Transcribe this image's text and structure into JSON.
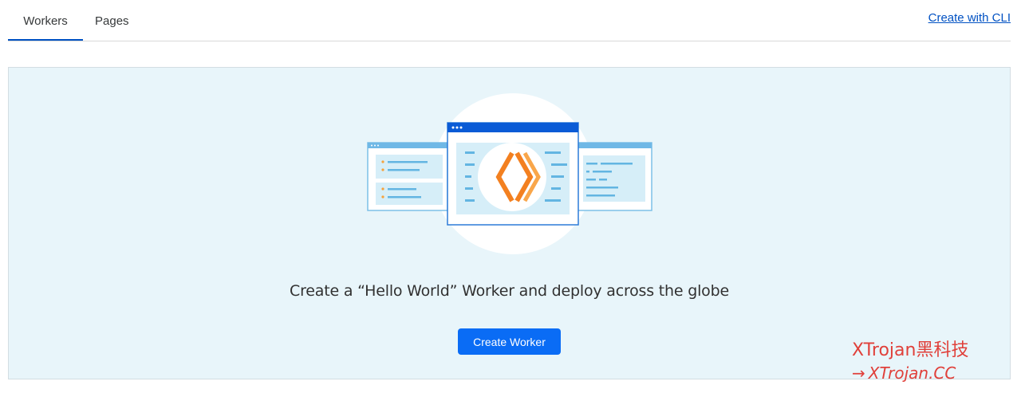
{
  "tabs": {
    "workers": "Workers",
    "pages": "Pages"
  },
  "header": {
    "create_cli_link": "Create with CLI"
  },
  "empty_state": {
    "headline": "Create a “Hello World” Worker and deploy across the globe",
    "button_label": "Create Worker",
    "illustration_icon": "code-brackets-icon"
  },
  "watermark": {
    "title": "XTrojan黑科技",
    "subtitle": "XTrojan.CC",
    "arrow": "→"
  },
  "colors": {
    "accent": "#0051c3",
    "button": "#0a6cf5",
    "panel_background": "#e8f5fa",
    "brand_orange": "#f38020",
    "watermark": "#e0403a"
  }
}
